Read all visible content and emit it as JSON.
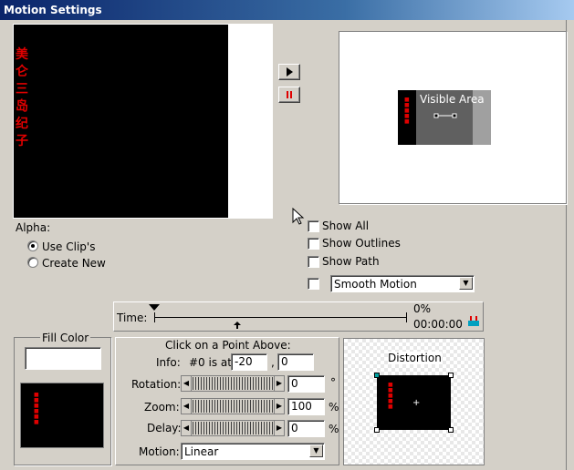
{
  "window": {
    "title": "Motion Settings"
  },
  "preview": {
    "chinese_text": [
      "美",
      "仑",
      "三",
      "岛",
      "纪",
      "子"
    ]
  },
  "playback": {
    "play_icon": "play-triangle-icon",
    "pause_icon": "pause-bars-icon"
  },
  "stage": {
    "visible_area_label": "Visible Area"
  },
  "alpha": {
    "label": "Alpha:",
    "options": [
      {
        "label": "Use Clip's",
        "selected": true
      },
      {
        "label": "Create New",
        "selected": false
      }
    ]
  },
  "options": {
    "show_all": "Show All",
    "show_outlines": "Show Outlines",
    "show_path": "Show Path",
    "motion_type": "Smooth Motion"
  },
  "timeline": {
    "time_label": "Time:",
    "percent": "0%",
    "timecode": "00:00:00"
  },
  "fill_color": {
    "label": "Fill Color",
    "value": ""
  },
  "point": {
    "heading": "Click on a Point Above:",
    "info_label": "Info:",
    "info_text": "#0 is at",
    "x": "-20",
    "y": "0",
    "rotation_label": "Rotation:",
    "rotation_value": "0",
    "rotation_unit": "°",
    "zoom_label": "Zoom:",
    "zoom_value": "100",
    "zoom_unit": "%",
    "delay_label": "Delay:",
    "delay_value": "0",
    "delay_unit": "%",
    "motion_label": "Motion:",
    "motion_value": "Linear"
  },
  "distortion": {
    "label": "Distortion"
  },
  "colors": {
    "accent_red": "#e00000",
    "title_blue": "#0a246a"
  }
}
